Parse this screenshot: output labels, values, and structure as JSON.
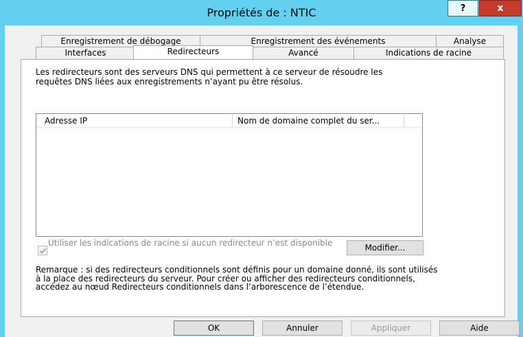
{
  "window": {
    "title": "Propriétés de : NTIC",
    "help_glyph": "?",
    "close_glyph": "x"
  },
  "tabs": {
    "row_top": [
      {
        "label": "Enregistrement de débogage"
      },
      {
        "label": "Enregistrement des événements"
      },
      {
        "label": "Analyse"
      }
    ],
    "row_bottom": [
      {
        "label": "Interfaces"
      },
      {
        "label": "Redirecteurs",
        "active": true
      },
      {
        "label": "Avancé"
      },
      {
        "label": "Indications de racine"
      }
    ]
  },
  "panel": {
    "description": "Les redirecteurs sont des serveurs DNS qui permettent à ce serveur de résoudre les requêtes DNS liées aux enregistrements n’ayant pu être résolus.",
    "list": {
      "columns": [
        "Adresse IP",
        "Nom de domaine complet du ser..."
      ],
      "rows": []
    },
    "use_root_hints": {
      "label": "Utiliser les indications de racine si aucun redirecteur n’est disponible",
      "checked": true,
      "enabled": false
    },
    "modify_button": "Modifier...",
    "remark": "Remarque : si des redirecteurs conditionnels sont définis pour un domaine donné, ils sont utilisés à la place des redirecteurs du serveur. Pour créer ou afficher des redirecteurs conditionnels, accédez au nœud Redirecteurs conditionnels dans l’arborescence de l’étendue."
  },
  "buttons": {
    "ok": "OK",
    "cancel": "Annuler",
    "apply": "Appliquer",
    "help": "Aide"
  },
  "colors": {
    "frame": "#62d0ee",
    "close": "#c53b2c"
  }
}
